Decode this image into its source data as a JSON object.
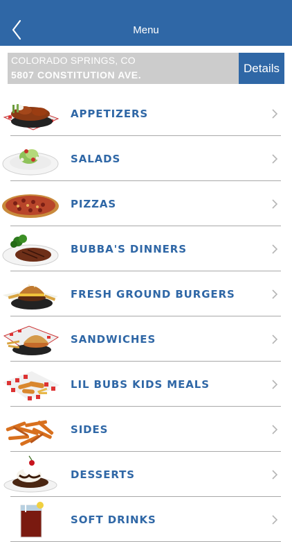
{
  "nav": {
    "title": "Menu",
    "back_icon": "chevron-left-icon"
  },
  "location": {
    "city": "COLORADO SPRINGS, CO",
    "address": "5807 CONSTITUTION AVE.",
    "details_label": "Details"
  },
  "colors": {
    "brand_blue": "#2f67a6",
    "location_bar_gray": "#cccccc",
    "divider": "#a8a8a8",
    "chevron": "#b5b5b5"
  },
  "menu": {
    "items": [
      {
        "label": "APPETIZERS",
        "icon": "appetizers-food-image"
      },
      {
        "label": "SALADS",
        "icon": "salad-food-image"
      },
      {
        "label": "PIZZAS",
        "icon": "pizza-food-image"
      },
      {
        "label": "BUBBA'S DINNERS",
        "icon": "steak-dinner-food-image"
      },
      {
        "label": "FRESH GROUND BURGERS",
        "icon": "burger-food-image"
      },
      {
        "label": "SANDWICHES",
        "icon": "sandwich-food-image"
      },
      {
        "label": "LIL BUBS KIDS MEALS",
        "icon": "kids-meal-food-image"
      },
      {
        "label": "SIDES",
        "icon": "fries-food-image"
      },
      {
        "label": "DESSERTS",
        "icon": "sundae-food-image"
      },
      {
        "label": "SOFT DRINKS",
        "icon": "soft-drink-food-image"
      }
    ]
  }
}
